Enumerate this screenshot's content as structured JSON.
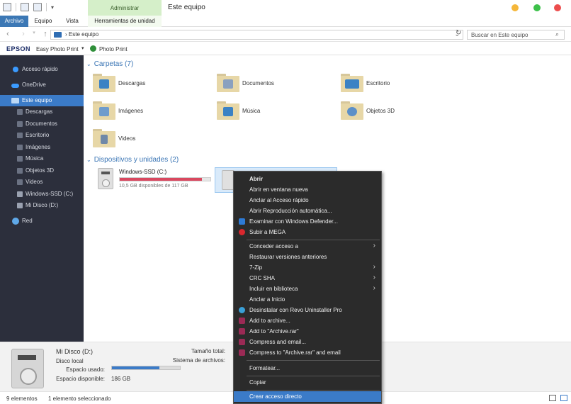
{
  "window": {
    "title": "Este equipo",
    "admin_tab": "Administrar",
    "ribbon_tabs": [
      {
        "label": "Archivo"
      },
      {
        "label": "Equipo"
      },
      {
        "label": "Vista"
      },
      {
        "label": "Herramientas de unidad"
      }
    ]
  },
  "address": {
    "crumb": "Este equipo",
    "search_placeholder": "Buscar en Este equipo"
  },
  "epson": {
    "brand": "EPSON",
    "easy_photo_print": "Easy Photo Print",
    "photo_print": "Photo Print"
  },
  "sidebar": {
    "items": [
      {
        "label": "Acceso rápido"
      },
      {
        "label": "OneDrive"
      },
      {
        "label": "Este equipo"
      },
      {
        "label": "Descargas"
      },
      {
        "label": "Documentos"
      },
      {
        "label": "Escritorio"
      },
      {
        "label": "Imágenes"
      },
      {
        "label": "Música"
      },
      {
        "label": "Objetos 3D"
      },
      {
        "label": "Videos"
      },
      {
        "label": "Windows-SSD (C:)"
      },
      {
        "label": "Mi Disco (D:)"
      },
      {
        "label": "Red"
      }
    ]
  },
  "main": {
    "folders_header": "Carpetas (7)",
    "folders": [
      {
        "label": "Descargas"
      },
      {
        "label": "Documentos"
      },
      {
        "label": "Escritorio"
      },
      {
        "label": "Imágenes"
      },
      {
        "label": "Música"
      },
      {
        "label": "Objetos 3D"
      },
      {
        "label": "Videos"
      }
    ],
    "devices_header": "Dispositivos y unidades (2)",
    "drives": [
      {
        "name": "Windows-SSD (C:)",
        "free": "10,5 GB disponibles de 117 GB",
        "used_fraction": 0.91
      },
      {
        "name": "",
        "free": "",
        "used_fraction": 0.0
      }
    ]
  },
  "details": {
    "name": "Mi Disco (D:)",
    "type": "Disco local",
    "used_label": "Espacio usado:",
    "used_fraction": 0.7,
    "free_label": "Espacio disponible:",
    "free_value": "186 GB",
    "total_label": "Tamaño total:",
    "fs_label": "Sistema de archivos:"
  },
  "status": {
    "count": "9 elementos",
    "selected": "1 elemento seleccionado"
  },
  "context_menu": {
    "items": [
      {
        "label": "Abrir"
      },
      {
        "label": "Abrir en ventana nueva"
      },
      {
        "label": "Anclar al Acceso rápido"
      },
      {
        "label": "Abrir Reproducción automática..."
      },
      {
        "label": "Examinar con Windows Defender..."
      },
      {
        "label": "Subir a MEGA"
      },
      {
        "label": "Conceder acceso a"
      },
      {
        "label": "Restaurar versiones anteriores"
      },
      {
        "label": "7-Zip"
      },
      {
        "label": "CRC SHA"
      },
      {
        "label": "Incluir en biblioteca"
      },
      {
        "label": "Anclar a Inicio"
      },
      {
        "label": "Desinstalar con Revo Uninstaller Pro"
      },
      {
        "label": "Add to archive..."
      },
      {
        "label": "Add to \"Archive.rar\""
      },
      {
        "label": "Compress and email..."
      },
      {
        "label": "Compress to \"Archive.rar\" and email"
      },
      {
        "label": "Formatear..."
      },
      {
        "label": "Copiar"
      },
      {
        "label": "Crear acceso directo"
      }
    ]
  },
  "colors": {
    "accent": "#3b7bc8",
    "sidebar_bg": "#2c2f3c",
    "menu_bg": "#2b2b2b",
    "drive_c_bar": "#d9485f",
    "admin_tab_bg": "#d5efc9"
  }
}
